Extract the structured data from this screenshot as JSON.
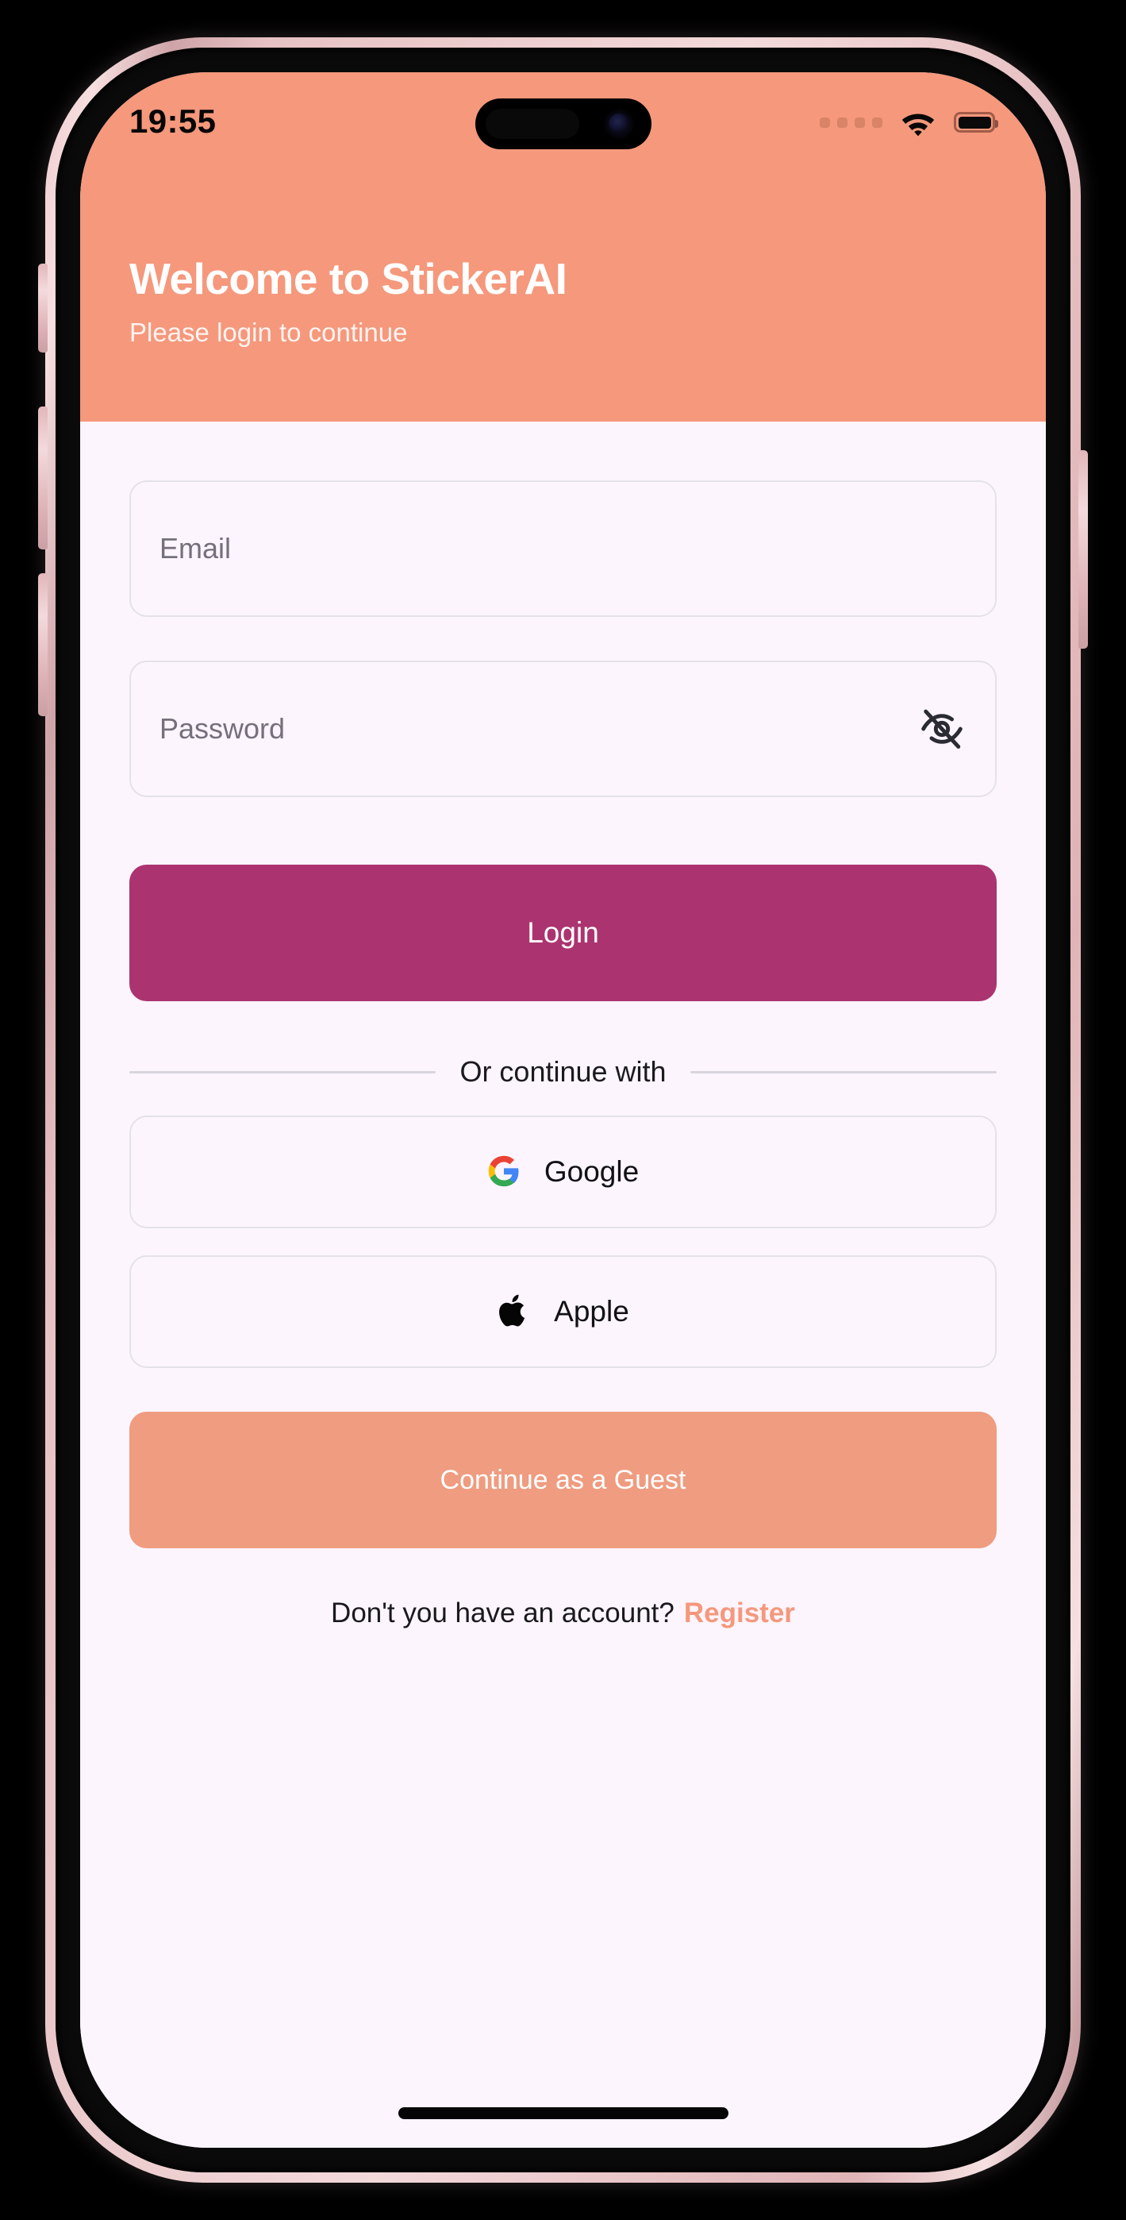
{
  "device": {
    "frame_color": "#EFC9CC",
    "screen_bg": "#FCF5FE"
  },
  "status_bar": {
    "time": "19:55",
    "signal_icon": "signal-dots-icon",
    "wifi_icon": "wifi-icon",
    "battery_icon": "battery-icon"
  },
  "header": {
    "background_color": "#F5987C",
    "title": "Welcome to StickerAI",
    "subtitle": "Please login to continue"
  },
  "form": {
    "email": {
      "placeholder": "Email",
      "value": ""
    },
    "password": {
      "placeholder": "Password",
      "value": "",
      "toggle_icon": "eye-off-icon"
    },
    "login_label": "Login",
    "login_color": "#AB3470"
  },
  "divider": {
    "label": "Or continue with"
  },
  "social": [
    {
      "label": "Google",
      "icon": "google-icon"
    },
    {
      "label": "Apple",
      "icon": "apple-icon"
    }
  ],
  "guest": {
    "label": "Continue as a Guest",
    "color": "#EF9C80"
  },
  "register": {
    "question": "Don't you have an account?",
    "link": "Register",
    "link_color": "#F5987C"
  }
}
